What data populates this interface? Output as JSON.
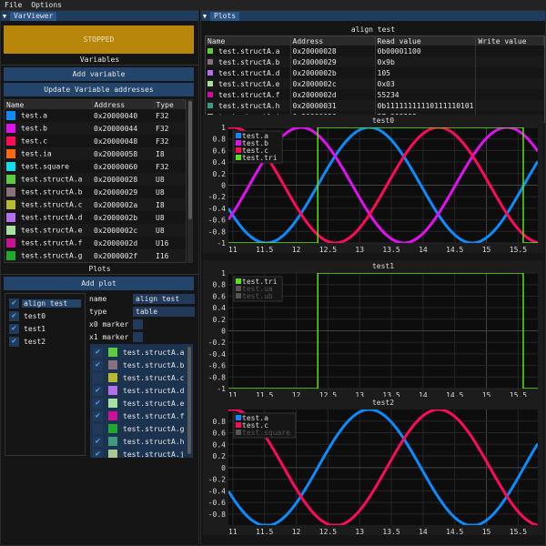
{
  "menu": {
    "items": [
      "File",
      "Options"
    ]
  },
  "left": {
    "tab": "VarViewer",
    "status": "STOPPED",
    "status_color": "#b8860b",
    "variables_header": "Variables",
    "add_variable": "Add variable",
    "update_addresses": "Update Variable addresses",
    "columns": [
      "Name",
      "Address",
      "Type"
    ],
    "variables": [
      {
        "name": "test.a",
        "address": "0x20000040",
        "type": "F32",
        "color": "#0a8cff"
      },
      {
        "name": "test.b",
        "address": "0x20000044",
        "type": "F32",
        "color": "#e010f0"
      },
      {
        "name": "test.c",
        "address": "0x20000048",
        "type": "F32",
        "color": "#ff0a5a"
      },
      {
        "name": "test.ia",
        "address": "0x20000058",
        "type": "I8",
        "color": "#ff6a10"
      },
      {
        "name": "test.square",
        "address": "0x20000060",
        "type": "F32",
        "color": "#10ddf0"
      },
      {
        "name": "test.structA.a",
        "address": "0x20000028",
        "type": "U8",
        "color": "#5ccc3a"
      },
      {
        "name": "test.structA.b",
        "address": "0x20000029",
        "type": "U8",
        "color": "#8a6f7c"
      },
      {
        "name": "test.structA.c",
        "address": "0x2000002a",
        "type": "I8",
        "color": "#b8ba30"
      },
      {
        "name": "test.structA.d",
        "address": "0x2000002b",
        "type": "U8",
        "color": "#b46ef0"
      },
      {
        "name": "test.structA.e",
        "address": "0x2000002c",
        "type": "U8",
        "color": "#a8e0a4"
      },
      {
        "name": "test.structA.f",
        "address": "0x2000002d",
        "type": "U16",
        "color": "#cc1199"
      },
      {
        "name": "test.structA.g",
        "address": "0x2000002f",
        "type": "I16",
        "color": "#1eaa2a"
      }
    ],
    "plots_header": "Plots",
    "add_plot": "Add plot",
    "plot_list": [
      {
        "name": "align test",
        "checked": true,
        "selected": true
      },
      {
        "name": "test0",
        "checked": true
      },
      {
        "name": "test1",
        "checked": true
      },
      {
        "name": "test2",
        "checked": true
      }
    ],
    "props": {
      "name_label": "name",
      "name_value": "align test",
      "type_label": "type",
      "type_value": "table",
      "x0_label": "x0 marker",
      "x1_label": "x1 marker"
    },
    "plot_vars": [
      {
        "name": "test.structA.a",
        "checked": true,
        "color": "#5ccc3a"
      },
      {
        "name": "test.structA.b",
        "checked": true,
        "color": "#8a6f7c"
      },
      {
        "name": "test.structA.c",
        "checked": false,
        "color": "#b8ba30"
      },
      {
        "name": "test.structA.d",
        "checked": true,
        "color": "#b46ef0"
      },
      {
        "name": "test.structA.e",
        "checked": true,
        "color": "#a8e0a4"
      },
      {
        "name": "test.structA.f",
        "checked": true,
        "color": "#cc1199"
      },
      {
        "name": "test.structA.g",
        "checked": false,
        "color": "#1eaa2a"
      },
      {
        "name": "test.structA.h",
        "checked": true,
        "color": "#3f9a80"
      },
      {
        "name": "test.structA.j",
        "checked": true,
        "color": "#a8c890"
      }
    ]
  },
  "right": {
    "tab": "Plots",
    "table_title": "align test",
    "columns": [
      "Name",
      "Address",
      "Read value",
      "Write value"
    ],
    "rows": [
      {
        "name": "test.structA.a",
        "address": "0x20000028",
        "read": "0b00001100",
        "write": "",
        "color": "#5ccc3a"
      },
      {
        "name": "test.structA.b",
        "address": "0x20000029",
        "read": "0x9b",
        "write": "",
        "color": "#8a6f7c"
      },
      {
        "name": "test.structA.d",
        "address": "0x2000002b",
        "read": "105",
        "write": "",
        "color": "#b46ef0"
      },
      {
        "name": "test.structA.e",
        "address": "0x2000002c",
        "read": "0x03",
        "write": "",
        "color": "#a8e0a4"
      },
      {
        "name": "test.structA.f",
        "address": "0x2000002d",
        "read": "55234",
        "write": "",
        "color": "#cc1199"
      },
      {
        "name": "test.structA.h",
        "address": "0x20000031",
        "read": "0b11111111110111110101",
        "write": "",
        "color": "#3f9a80"
      },
      {
        "name": "test.structA.j",
        "address": "0x20000036",
        "read": "37.209999",
        "write": "",
        "color": "#a8c890"
      }
    ]
  },
  "chart_data": [
    {
      "type": "line",
      "title": "test0",
      "xlim": [
        10.93,
        15.81
      ],
      "ylim": [
        -1,
        1
      ],
      "xticks": [
        "11",
        "11.5",
        "12",
        "12.5",
        "13",
        "13.5",
        "14",
        "14.5",
        "15",
        "15.5"
      ],
      "yticks": [
        "1",
        "0.8",
        "0.6",
        "0.4",
        "0.2",
        "0",
        "-0.2",
        "-0.4",
        "-0.6",
        "-0.8",
        "-1"
      ],
      "legend_position": "top-left",
      "grid": true,
      "series": [
        {
          "name": "test.a",
          "kind": "sine",
          "period": 3.25,
          "zero_rise": 12.34,
          "color": "#0a8cff",
          "visible": true
        },
        {
          "name": "test.b",
          "kind": "sine",
          "period": 3.25,
          "zero_rise": 11.26,
          "color": "#e010f0",
          "visible": true
        },
        {
          "name": "test.c",
          "kind": "sine",
          "period": 3.25,
          "zero_rise": 10.18,
          "color": "#ff0a5a",
          "visible": true
        },
        {
          "name": "test.tri",
          "kind": "step",
          "points": [
            [
              10.93,
              -1
            ],
            [
              12.34,
              -1
            ],
            [
              12.34,
              1
            ],
            [
              15.58,
              1
            ],
            [
              15.58,
              -1
            ],
            [
              15.81,
              -1
            ]
          ],
          "color": "#5fe010",
          "visible": true
        }
      ]
    },
    {
      "type": "line",
      "title": "test1",
      "xlim": [
        10.93,
        15.81
      ],
      "ylim": [
        -1,
        1
      ],
      "xticks": [
        "11",
        "11.5",
        "12",
        "12.5",
        "13",
        "13.5",
        "14",
        "14.5",
        "15",
        "15.5"
      ],
      "yticks": [
        "1",
        "0.8",
        "0.6",
        "0.4",
        "0.2",
        "0",
        "-0.2",
        "-0.4",
        "-0.6",
        "-0.8",
        "-1"
      ],
      "legend_position": "top-left",
      "grid": true,
      "series": [
        {
          "name": "test.tri",
          "kind": "step",
          "points": [
            [
              10.93,
              -1
            ],
            [
              12.34,
              -1
            ],
            [
              12.34,
              1
            ],
            [
              15.58,
              1
            ],
            [
              15.58,
              -1
            ],
            [
              15.81,
              -1
            ]
          ],
          "color": "#5fe010",
          "visible": true
        },
        {
          "name": "test.ua",
          "color": "#555555",
          "visible": false
        },
        {
          "name": "test.ub",
          "color": "#555555",
          "visible": false
        }
      ]
    },
    {
      "type": "line",
      "title": "test2",
      "xlim": [
        10.93,
        15.81
      ],
      "ylim": [
        -0.99,
        1
      ],
      "xticks": [
        "11",
        "11.5",
        "12",
        "12.5",
        "13",
        "13.5",
        "14",
        "14.5",
        "15",
        "15.5"
      ],
      "yticks": [
        "0.8",
        "0.6",
        "0.4",
        "0.2",
        "0",
        "-0.2",
        "-0.4",
        "-0.6",
        "-0.8"
      ],
      "legend_position": "top-left",
      "grid": true,
      "series": [
        {
          "name": "test.a",
          "kind": "sine",
          "period": 3.25,
          "zero_rise": 12.34,
          "color": "#0a8cff",
          "visible": true
        },
        {
          "name": "test.c",
          "kind": "sine",
          "period": 3.25,
          "zero_rise": 10.18,
          "color": "#ff0a5a",
          "visible": true
        },
        {
          "name": "test.square",
          "color": "#555555",
          "visible": false
        }
      ]
    }
  ]
}
